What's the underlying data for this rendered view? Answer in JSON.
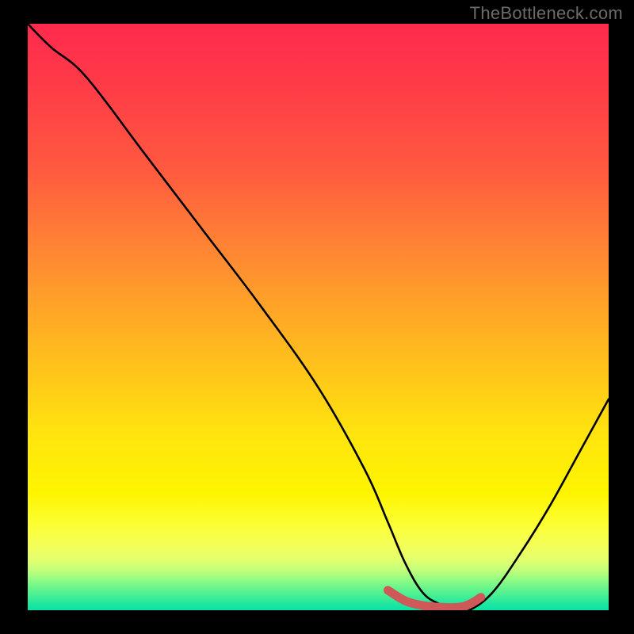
{
  "watermark": "TheBottleneck.com",
  "chart_data": {
    "type": "line",
    "title": "",
    "xlabel": "",
    "ylabel": "",
    "xlim": [
      0,
      100
    ],
    "ylim": [
      0,
      100
    ],
    "grid": false,
    "series": [
      {
        "name": "bottleneck-curve",
        "color": "#000000",
        "x": [
          0,
          4,
          10,
          20,
          30,
          40,
          50,
          58,
          62,
          65,
          68,
          71,
          74,
          76,
          80,
          85,
          90,
          95,
          100
        ],
        "y": [
          100,
          96,
          91,
          78,
          65,
          52,
          38,
          24,
          15,
          8,
          3,
          1,
          0,
          0,
          3,
          10,
          18,
          27,
          36
        ]
      },
      {
        "name": "optimal-band",
        "color": "#cf5858",
        "x": [
          62,
          65,
          68,
          71,
          74,
          76,
          78
        ],
        "y": [
          3.4,
          1.6,
          0.8,
          0.5,
          0.5,
          1.0,
          2.2
        ]
      }
    ],
    "annotations": []
  },
  "colors": {
    "gradient_top": "#ff2a4d",
    "gradient_mid": "#ffe40e",
    "gradient_bottom": "#08e2a6",
    "curve": "#000000",
    "band": "#cf5858",
    "frame": "#000000",
    "watermark": "#6b6b6b"
  }
}
